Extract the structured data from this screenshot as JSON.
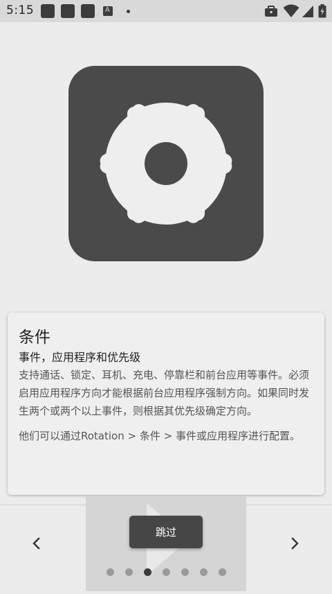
{
  "status_bar": {
    "time": "5:15"
  },
  "card": {
    "title": "条件",
    "subtitle": "事件，应用程序和优先级",
    "body_1": "支持通话、锁定、耳机、充电、停靠栏和前台应用等事件。必须启用应用程序方向才能根据前台应用程序强制方向。如果同时发生两个或两个以上事件，则根据其优先级确定方向。",
    "body_2": "他们可以通过Rotation > 条件 > 事件或应用程序进行配置。"
  },
  "footer": {
    "skip_label": "跳过",
    "page_count": 7,
    "current_page": 3
  },
  "colors": {
    "background": "#ececec",
    "status_bar": "#d9d9d9",
    "icon_tile": "#4a4a4a",
    "gear": "#eeeeee",
    "button": "#464646",
    "dot_inactive": "#9a9a9a",
    "dot_active": "#3a3a3a"
  },
  "icons": {
    "hero": "settings-gear-icon",
    "prev": "chevron-left-icon",
    "next": "chevron-right-icon",
    "status": [
      "notification-icon",
      "notification-icon",
      "notification-icon",
      "font-icon",
      "dot-icon",
      "work-briefcase-icon",
      "wifi-icon",
      "signal-icon",
      "battery-charging-icon"
    ]
  }
}
